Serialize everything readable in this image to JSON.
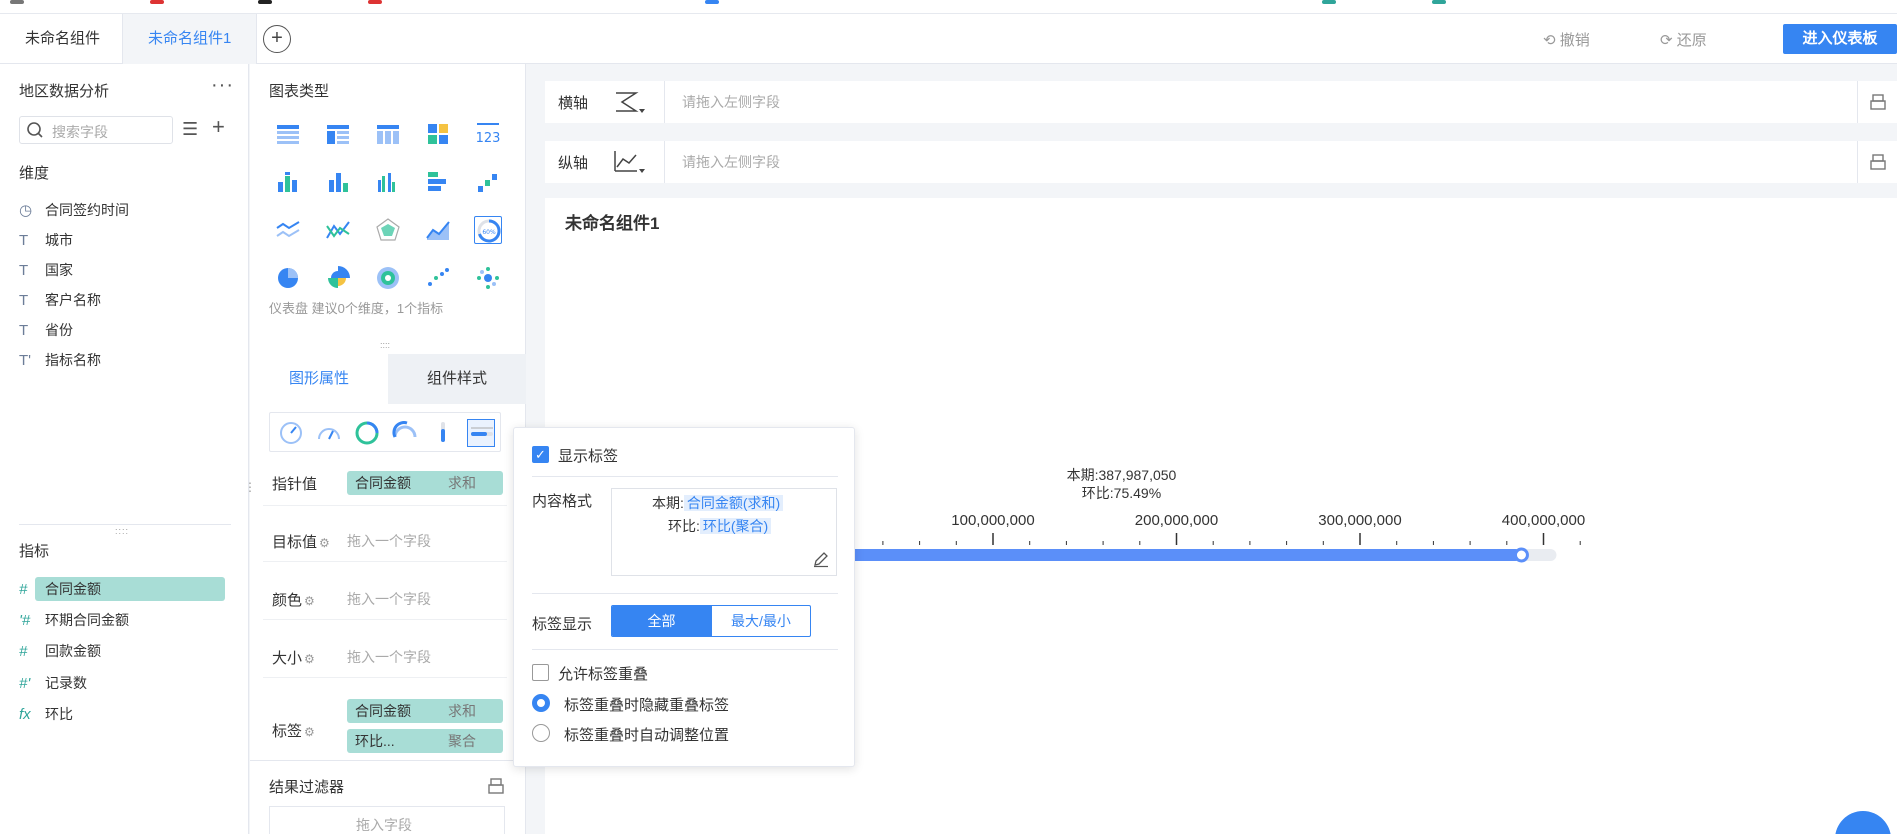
{
  "tabs": [
    "未命名组件",
    "未命名组件1"
  ],
  "toolbar": {
    "undo": "撤销",
    "redo": "还原",
    "enter_dashboard": "进入仪表板"
  },
  "left": {
    "title": "地区数据分析",
    "more": "···",
    "search_placeholder": "搜索字段",
    "dimension_label": "维度",
    "dimensions": [
      {
        "icon": "clock",
        "label": "合同签约时间"
      },
      {
        "icon": "T",
        "label": "城市"
      },
      {
        "icon": "T",
        "label": "国家"
      },
      {
        "icon": "T",
        "label": "客户名称"
      },
      {
        "icon": "T",
        "label": "省份"
      },
      {
        "icon": "T'",
        "label": "指标名称"
      }
    ],
    "measure_label": "指标",
    "measures": [
      {
        "icon": "#",
        "label": "合同金额"
      },
      {
        "icon": "#",
        "label": "环期合同金额"
      },
      {
        "icon": "#",
        "label": "回款金额"
      },
      {
        "icon": "#'",
        "label": "记录数"
      },
      {
        "icon": "fx",
        "label": "环比"
      }
    ]
  },
  "middle": {
    "chart_type_title": "图表类型",
    "chart_hint": "仪表盘 建议0个维度，1个指标",
    "prop_tabs": [
      "图形属性",
      "组件样式"
    ],
    "rows": {
      "pointer": {
        "label": "指针值",
        "field": "合同金额",
        "agg": "求和"
      },
      "target": {
        "label": "目标值",
        "placeholder": "拖入一个字段"
      },
      "color": {
        "label": "颜色",
        "placeholder": "拖入一个字段"
      },
      "size": {
        "label": "大小",
        "placeholder": "拖入一个字段"
      },
      "label": {
        "label": "标签",
        "field1": "合同金额",
        "agg1": "求和",
        "field2": "环比...",
        "agg2": "聚合"
      }
    },
    "result_filter": "结果过滤器",
    "filter_placeholder": "拖入字段"
  },
  "axes": {
    "x_label": "横轴",
    "y_label": "纵轴",
    "placeholder": "请拖入左侧字段"
  },
  "canvas": {
    "component_title": "未命名组件1"
  },
  "chart_data": {
    "type": "gauge",
    "style": "horizontal-progress",
    "value": 387987050,
    "tick_labels": [
      "100,000,000",
      "200,000,000",
      "300,000,000",
      "400,000,000"
    ],
    "ticks": [
      100000000,
      200000000,
      300000000,
      400000000
    ],
    "label_line1": "本期:387,987,050",
    "label_line2": "环比:75.49%",
    "bar_color": "#5b8ff9"
  },
  "popover": {
    "show_label": "显示标签",
    "content_format": "内容格式",
    "fmt_prefix1": "本期:",
    "fmt_field1": "合同金额(求和)",
    "fmt_prefix2": "环比:",
    "fmt_field2": "环比(聚合)",
    "label_display": "标签显示",
    "seg_all": "全部",
    "seg_maxmin": "最大/最小",
    "allow_overlap": "允许标签重叠",
    "radio1": "标签重叠时隐藏重叠标签",
    "radio2": "标签重叠时自动调整位置"
  }
}
